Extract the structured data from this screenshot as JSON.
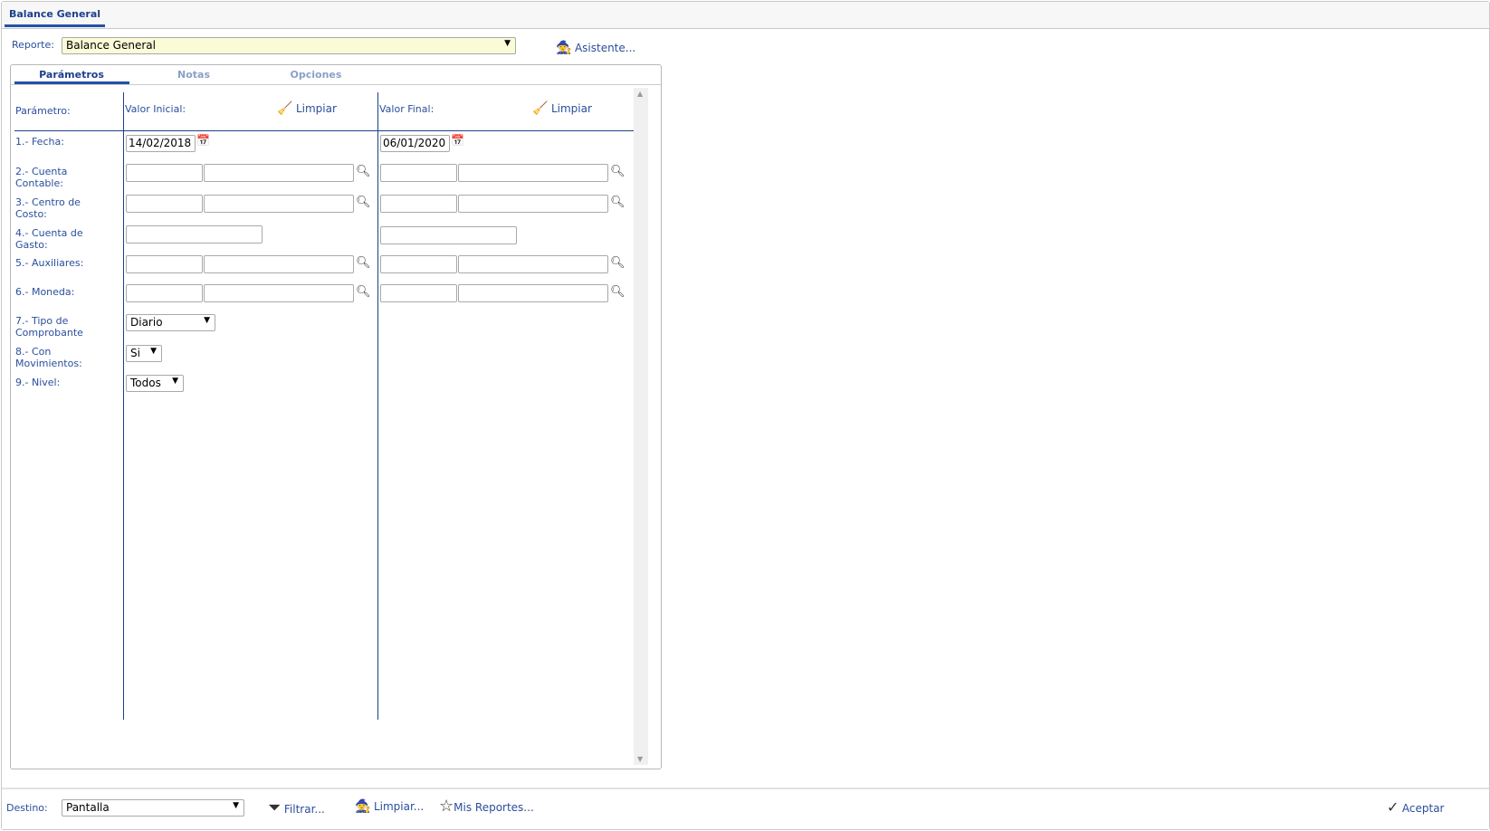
{
  "window_tab": "Balance General",
  "report": {
    "label": "Reporte:",
    "value": "Balance General",
    "assistant": "Asistente..."
  },
  "tabs": [
    "Parámetros",
    "Notas",
    "Opciones"
  ],
  "header": {
    "param": "Parámetro:",
    "initial": "Valor Inicial:",
    "final": "Valor Final:",
    "clear": "Limpiar"
  },
  "params": [
    {
      "label": "1.- Fecha:",
      "initial": "14/02/2018",
      "final": "06/01/2020"
    },
    {
      "label": "2.- Cuenta Contable:"
    },
    {
      "label": "3.- Centro de Costo:"
    },
    {
      "label": "4.- Cuenta de Gasto:"
    },
    {
      "label": "5.- Auxiliares:"
    },
    {
      "label": "6.- Moneda:"
    },
    {
      "label": "7.- Tipo de Comprobante",
      "value": "Diario"
    },
    {
      "label": "8.- Con Movimientos:",
      "value": "Si"
    },
    {
      "label": "9.- Nivel:",
      "value": "Todos"
    }
  ],
  "footer": {
    "dest_label": "Destino:",
    "dest_value": "Pantalla",
    "filter": "Filtrar...",
    "clear": "Limpiar...",
    "my_reports": "Mis Reportes...",
    "accept": "Aceptar"
  }
}
